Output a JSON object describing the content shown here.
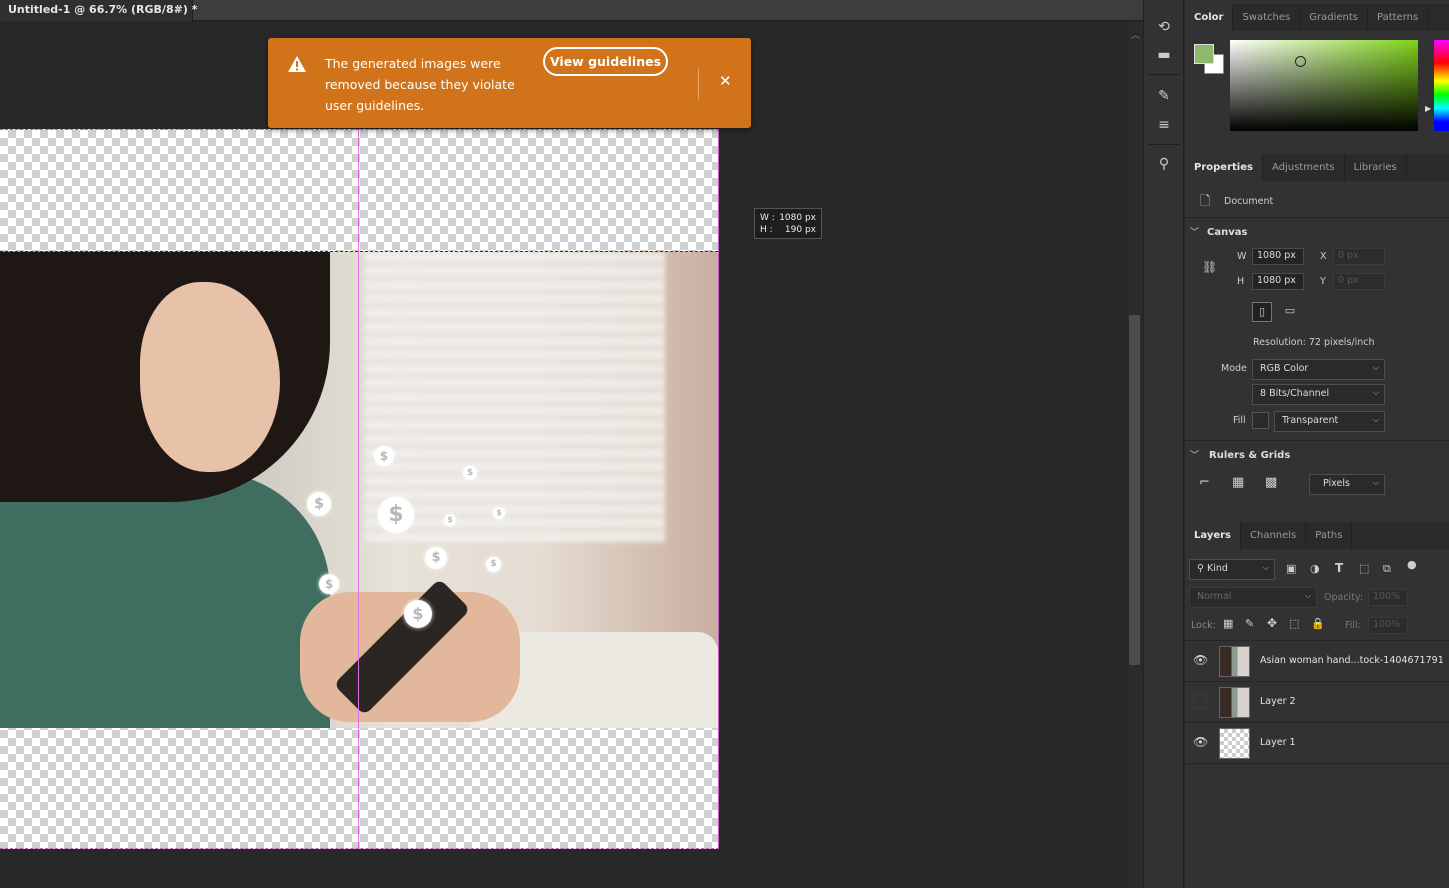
{
  "tab": {
    "title": "Untitled-1 @ 66.7% (RGB/8#) *",
    "close": "×"
  },
  "notification": {
    "message": "The generated images were removed because they violate user guidelines.",
    "button": "View guidelines",
    "close": "✕",
    "bg": "#d1731a"
  },
  "dims_tooltip": {
    "w_label": "W :",
    "w_value": "1080 px",
    "h_label": "H :",
    "h_value": "190 px"
  },
  "color_panel": {
    "tabs": [
      "Color",
      "Swatches",
      "Gradients",
      "Patterns"
    ],
    "foreground": "#8fb86a",
    "background": "#ffffff"
  },
  "properties": {
    "tabs": [
      "Properties",
      "Adjustments",
      "Libraries"
    ],
    "doc_label": "Document",
    "canvas": {
      "title": "Canvas",
      "w_label": "W",
      "w_value": "1080 px",
      "h_label": "H",
      "h_value": "1080 px",
      "x_label": "X",
      "x_value": "0 px",
      "y_label": "Y",
      "y_value": "0 px",
      "resolution": "Resolution: 72 pixels/inch",
      "mode_label": "Mode",
      "mode_value": "RGB Color",
      "bits_value": "8 Bits/Channel",
      "fill_label": "Fill",
      "fill_value": "Transparent"
    },
    "rulers": {
      "title": "Rulers & Grids",
      "units": "Pixels"
    }
  },
  "layers_panel": {
    "tabs": [
      "Layers",
      "Channels",
      "Paths"
    ],
    "filter": "Kind",
    "blend_mode": "Normal",
    "opacity_label": "Opacity:",
    "opacity_value": "100%",
    "lock_label": "Lock:",
    "fill_label": "Fill:",
    "fill_value": "100%",
    "layers": [
      {
        "name": "Asian woman hand...tock-1404671791",
        "visible": true
      },
      {
        "name": "Layer 2",
        "visible": false
      },
      {
        "name": "Layer 1",
        "visible": true
      }
    ]
  }
}
